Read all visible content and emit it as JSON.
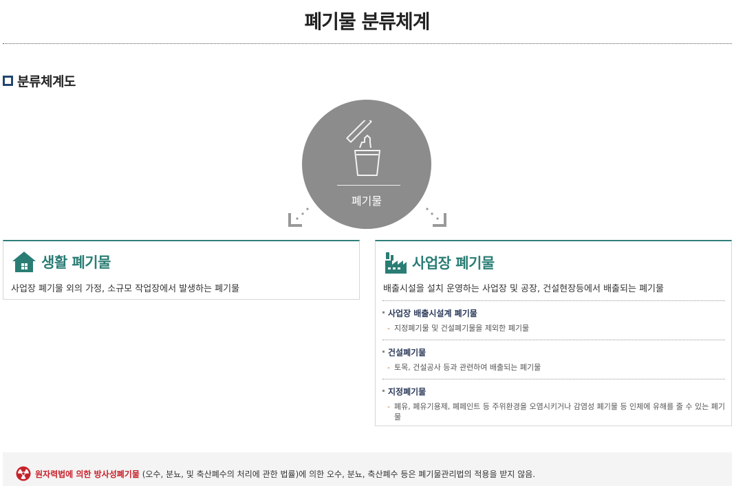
{
  "page": {
    "title": "폐기물 분류체계"
  },
  "section": {
    "heading": "분류체계도"
  },
  "diagram": {
    "root_label": "폐기물",
    "root_icon": "trash-bin-icon",
    "colors": {
      "circle": "#8c8c8c",
      "accent": "#2a7d74",
      "border_top": "#2f7f78"
    }
  },
  "household": {
    "icon": "house-icon",
    "title": "생활 폐기물",
    "description": "사업장 폐기물 외의 가정, 소규모 작업장에서 발생하는 폐기물"
  },
  "business": {
    "icon": "factory-icon",
    "title": "사업장 폐기물",
    "description": "배출시설을 설치 운영하는 사업장 및 공장, 건설현장등에서 배출되는 폐기물",
    "items": [
      {
        "title": "사업장 배출시설계 폐기물",
        "description": "지정폐기물 및 건설폐기물을 제외한 폐기물"
      },
      {
        "title": "건설폐기물",
        "description": "토목, 건설공사 등과 관련하여 배출되는 폐기물"
      },
      {
        "title": "지정폐기물",
        "description": "폐유, 폐유기용제, 폐페인트 등 주위환경을 오염시키거나 감염성 폐기물 등 인체에 유해를 줄 수 있는 폐기물"
      }
    ]
  },
  "notice": {
    "icon": "radiation-icon",
    "highlight": "원자력법에 의한 방사성폐기물",
    "text": " (오수, 분뇨, 및 축산폐수의 처리에 관한 법률)에 의한 오수, 분뇨, 축산폐수 등은 폐기물관리법의 적용을 받지 않음."
  }
}
